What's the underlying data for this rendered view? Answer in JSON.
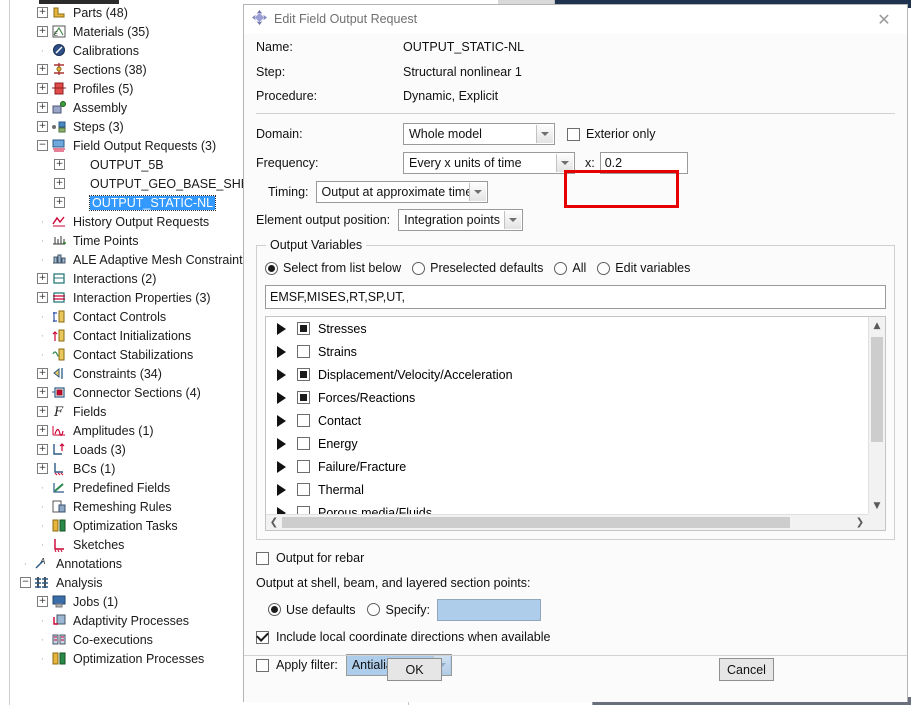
{
  "model_tree": {
    "items": [
      {
        "label": "Parts (48)",
        "expander": "+",
        "icon": "parts-icon",
        "indent": 0,
        "selected": false
      },
      {
        "label": "Materials (35)",
        "expander": "+",
        "icon": "materials-icon",
        "indent": 0,
        "selected": false
      },
      {
        "label": "Calibrations",
        "expander": "",
        "icon": "calibrations-icon",
        "indent": 0,
        "selected": false
      },
      {
        "label": "Sections (38)",
        "expander": "+",
        "icon": "sections-icon",
        "indent": 0,
        "selected": false
      },
      {
        "label": "Profiles (5)",
        "expander": "+",
        "icon": "profiles-icon",
        "indent": 0,
        "selected": false
      },
      {
        "label": "Assembly",
        "expander": "+",
        "icon": "assembly-icon",
        "indent": 0,
        "selected": false
      },
      {
        "label": "Steps (3)",
        "expander": "+",
        "icon": "steps-icon",
        "indent": 0,
        "selected": false
      },
      {
        "label": "Field Output Requests (3)",
        "expander": "-",
        "icon": "field-output-icon",
        "indent": 0,
        "selected": false
      },
      {
        "label": "OUTPUT_5B",
        "expander": "+",
        "icon": "none",
        "indent": 1,
        "selected": false
      },
      {
        "label": "OUTPUT_GEO_BASE_SHEAR_TB",
        "expander": "+",
        "icon": "none",
        "indent": 1,
        "selected": false
      },
      {
        "label": "OUTPUT_STATIC-NL",
        "expander": "+",
        "icon": "none",
        "indent": 1,
        "selected": true
      },
      {
        "label": "History Output Requests",
        "expander": "",
        "icon": "history-output-icon",
        "indent": 0,
        "selected": false
      },
      {
        "label": "Time Points",
        "expander": "",
        "icon": "time-points-icon",
        "indent": 0,
        "selected": false
      },
      {
        "label": "ALE Adaptive Mesh Constraints",
        "expander": "",
        "icon": "ale-mesh-icon",
        "indent": 0,
        "selected": false
      },
      {
        "label": "Interactions (2)",
        "expander": "+",
        "icon": "interactions-icon",
        "indent": 0,
        "selected": false
      },
      {
        "label": "Interaction Properties (3)",
        "expander": "+",
        "icon": "interaction-properties-icon",
        "indent": 0,
        "selected": false
      },
      {
        "label": "Contact Controls",
        "expander": "",
        "icon": "contact-controls-icon",
        "indent": 0,
        "selected": false
      },
      {
        "label": "Contact Initializations",
        "expander": "",
        "icon": "contact-initializations-icon",
        "indent": 0,
        "selected": false
      },
      {
        "label": "Contact Stabilizations",
        "expander": "",
        "icon": "contact-stabilizations-icon",
        "indent": 0,
        "selected": false
      },
      {
        "label": "Constraints (34)",
        "expander": "+",
        "icon": "constraints-icon",
        "indent": 0,
        "selected": false
      },
      {
        "label": "Connector Sections (4)",
        "expander": "+",
        "icon": "connector-sections-icon",
        "indent": 0,
        "selected": false
      },
      {
        "label": "Fields",
        "expander": "+",
        "icon": "fields-icon",
        "indent": 0,
        "selected": false
      },
      {
        "label": "Amplitudes (1)",
        "expander": "+",
        "icon": "amplitudes-icon",
        "indent": 0,
        "selected": false
      },
      {
        "label": "Loads (3)",
        "expander": "+",
        "icon": "loads-icon",
        "indent": 0,
        "selected": false
      },
      {
        "label": "BCs (1)",
        "expander": "+",
        "icon": "bcs-icon",
        "indent": 0,
        "selected": false
      },
      {
        "label": "Predefined Fields",
        "expander": "",
        "icon": "predefined-fields-icon",
        "indent": 0,
        "selected": false
      },
      {
        "label": "Remeshing Rules",
        "expander": "",
        "icon": "remeshing-rules-icon",
        "indent": 0,
        "selected": false
      },
      {
        "label": "Optimization Tasks",
        "expander": "",
        "icon": "optimization-tasks-icon",
        "indent": 0,
        "selected": false
      },
      {
        "label": "Sketches",
        "expander": "",
        "icon": "sketches-icon",
        "indent": 0,
        "selected": false
      },
      {
        "label": "Annotations",
        "expander": "",
        "icon": "annotations-icon",
        "indent": -1,
        "selected": false
      },
      {
        "label": "Analysis",
        "expander": "-",
        "icon": "analysis-icon",
        "indent": -1,
        "selected": false
      },
      {
        "label": "Jobs (1)",
        "expander": "+",
        "icon": "jobs-icon",
        "indent": 0,
        "selected": false
      },
      {
        "label": "Adaptivity Processes",
        "expander": "",
        "icon": "adaptivity-processes-icon",
        "indent": 0,
        "selected": false
      },
      {
        "label": "Co-executions",
        "expander": "",
        "icon": "co-executions-icon",
        "indent": 0,
        "selected": false
      },
      {
        "label": "Optimization Processes",
        "expander": "",
        "icon": "optimization-processes-icon",
        "indent": 0,
        "selected": false
      }
    ]
  },
  "dialog": {
    "title": "Edit Field Output Request",
    "title_icon": "abaqus-diamond-icon",
    "close_icon": "close-icon",
    "info": {
      "name_label": "Name:",
      "name_value": "OUTPUT_STATIC-NL",
      "step_label": "Step:",
      "step_value": "Structural nonlinear 1",
      "procedure_label": "Procedure:",
      "procedure_value": "Dynamic, Explicit"
    },
    "domain": {
      "label": "Domain:",
      "value": "Whole model",
      "exterior_only_label": "Exterior only",
      "exterior_only_checked": false
    },
    "frequency": {
      "label": "Frequency:",
      "value": "Every x units of time",
      "x_label": "x:",
      "x_value": "0.2",
      "highlight_color": "#e60000"
    },
    "timing": {
      "label": "Timing:",
      "value": "Output at approximate times"
    },
    "element_output_position": {
      "label": "Element output position:",
      "value": "Integration points"
    },
    "output_variables": {
      "group_title": "Output Variables",
      "modes": [
        {
          "label": "Select from list below",
          "selected": true
        },
        {
          "label": "Preselected defaults",
          "selected": false
        },
        {
          "label": "All",
          "selected": false
        },
        {
          "label": "Edit variables",
          "selected": false
        }
      ],
      "variables_text": "EMSF,MISES,RT,SP,UT,",
      "tree": [
        {
          "label": "Stresses",
          "state": "partial"
        },
        {
          "label": "Strains",
          "state": "unchecked"
        },
        {
          "label": "Displacement/Velocity/Acceleration",
          "state": "partial"
        },
        {
          "label": "Forces/Reactions",
          "state": "partial"
        },
        {
          "label": "Contact",
          "state": "unchecked"
        },
        {
          "label": "Energy",
          "state": "unchecked"
        },
        {
          "label": "Failure/Fracture",
          "state": "unchecked"
        },
        {
          "label": "Thermal",
          "state": "unchecked"
        },
        {
          "label": "Porous media/Fluids",
          "state": "unchecked"
        }
      ],
      "scroll_up_icon": "chevron-up-icon",
      "scroll_down_icon": "chevron-down-icon",
      "scroll_left_icon": "chevron-left-icon",
      "scroll_right_icon": "chevron-right-icon"
    },
    "rebar": {
      "label": "Output for rebar",
      "checked": false
    },
    "section_points": {
      "label": "Output at shell, beam, and layered section points:",
      "use_defaults_label": "Use defaults",
      "use_defaults_selected": true,
      "specify_label": "Specify:",
      "specify_selected": false,
      "specify_value": ""
    },
    "local_coords": {
      "label": "Include local coordinate directions when available",
      "checked": true
    },
    "filter": {
      "label": "Apply filter:",
      "checked": false,
      "value": "Antialiasing"
    },
    "buttons": {
      "ok": "OK",
      "cancel": "Cancel"
    }
  }
}
